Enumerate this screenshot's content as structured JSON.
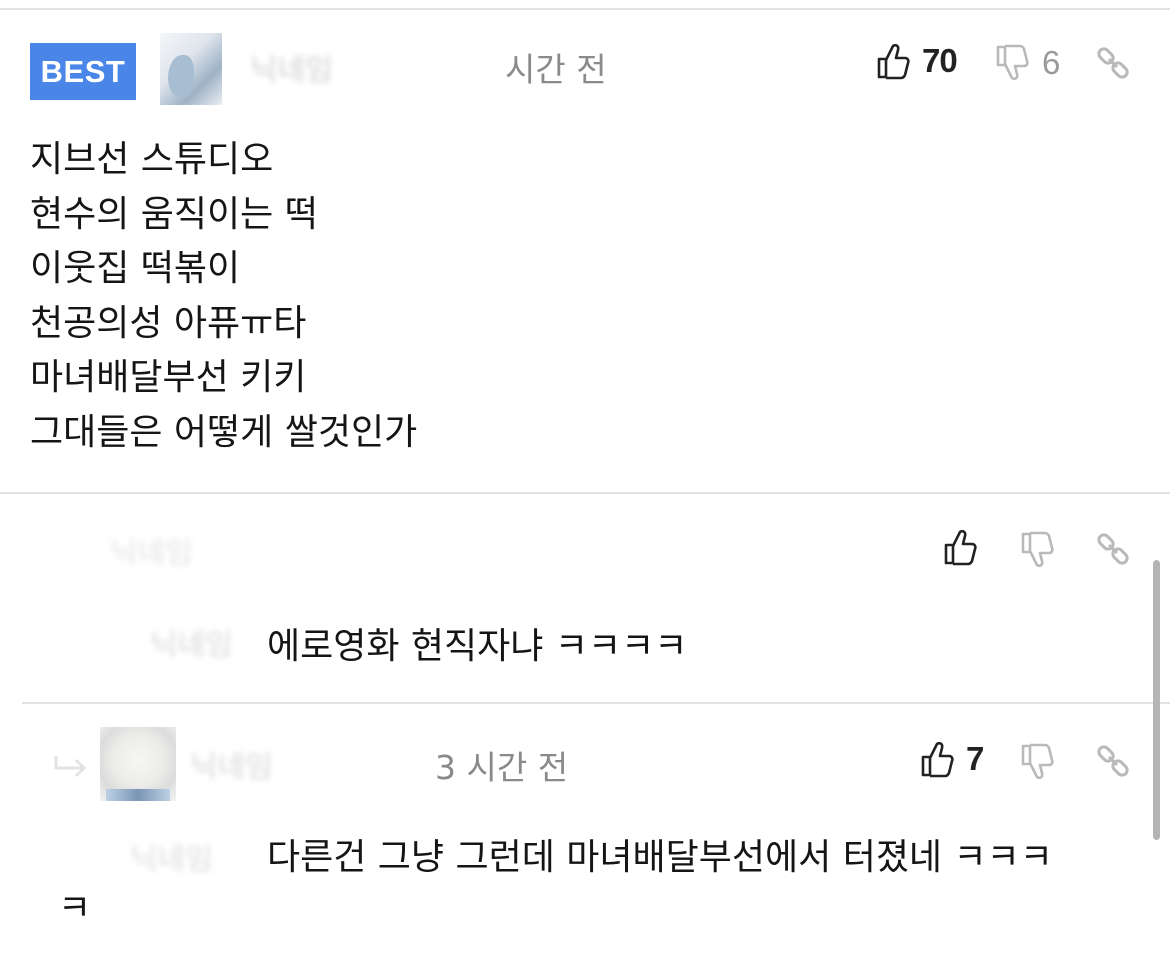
{
  "best_comment": {
    "badge": "BEST",
    "author_blurred": "닉네임",
    "time": "시간 전",
    "likes": "70",
    "dislikes": "6",
    "lines": [
      "지브선 스튜디오",
      "현수의 움직이는 떡",
      "이웃집 떡볶이",
      "천공의성 아퓨ㅠ타",
      "마녀배달부선 키키",
      "그대들은 어떻게 쌀것인가"
    ]
  },
  "reply_1": {
    "author_blurred": "닉네임",
    "mention_blurred": "닉네임",
    "text": "에로영화 현직자냐 ㅋㅋㅋㅋ"
  },
  "reply_2": {
    "author_blurred": "닉네임",
    "mention_blurred": "닉네임",
    "time": "3 시간 전",
    "likes": "7",
    "text_line1": "다른건 그냥 그런데 마녀배달부선에서 터졌네 ㅋㅋㅋ",
    "text_line2": "ㅋ"
  },
  "icons": {
    "like": "thumbs-up-icon",
    "dislike": "thumbs-down-icon",
    "link": "link-icon",
    "reply": "reply-arrow-icon"
  },
  "colors": {
    "badge": "#4a86e8",
    "muted": "#8a8a8a",
    "icon_muted": "#b9b9b9",
    "text": "#151515"
  }
}
